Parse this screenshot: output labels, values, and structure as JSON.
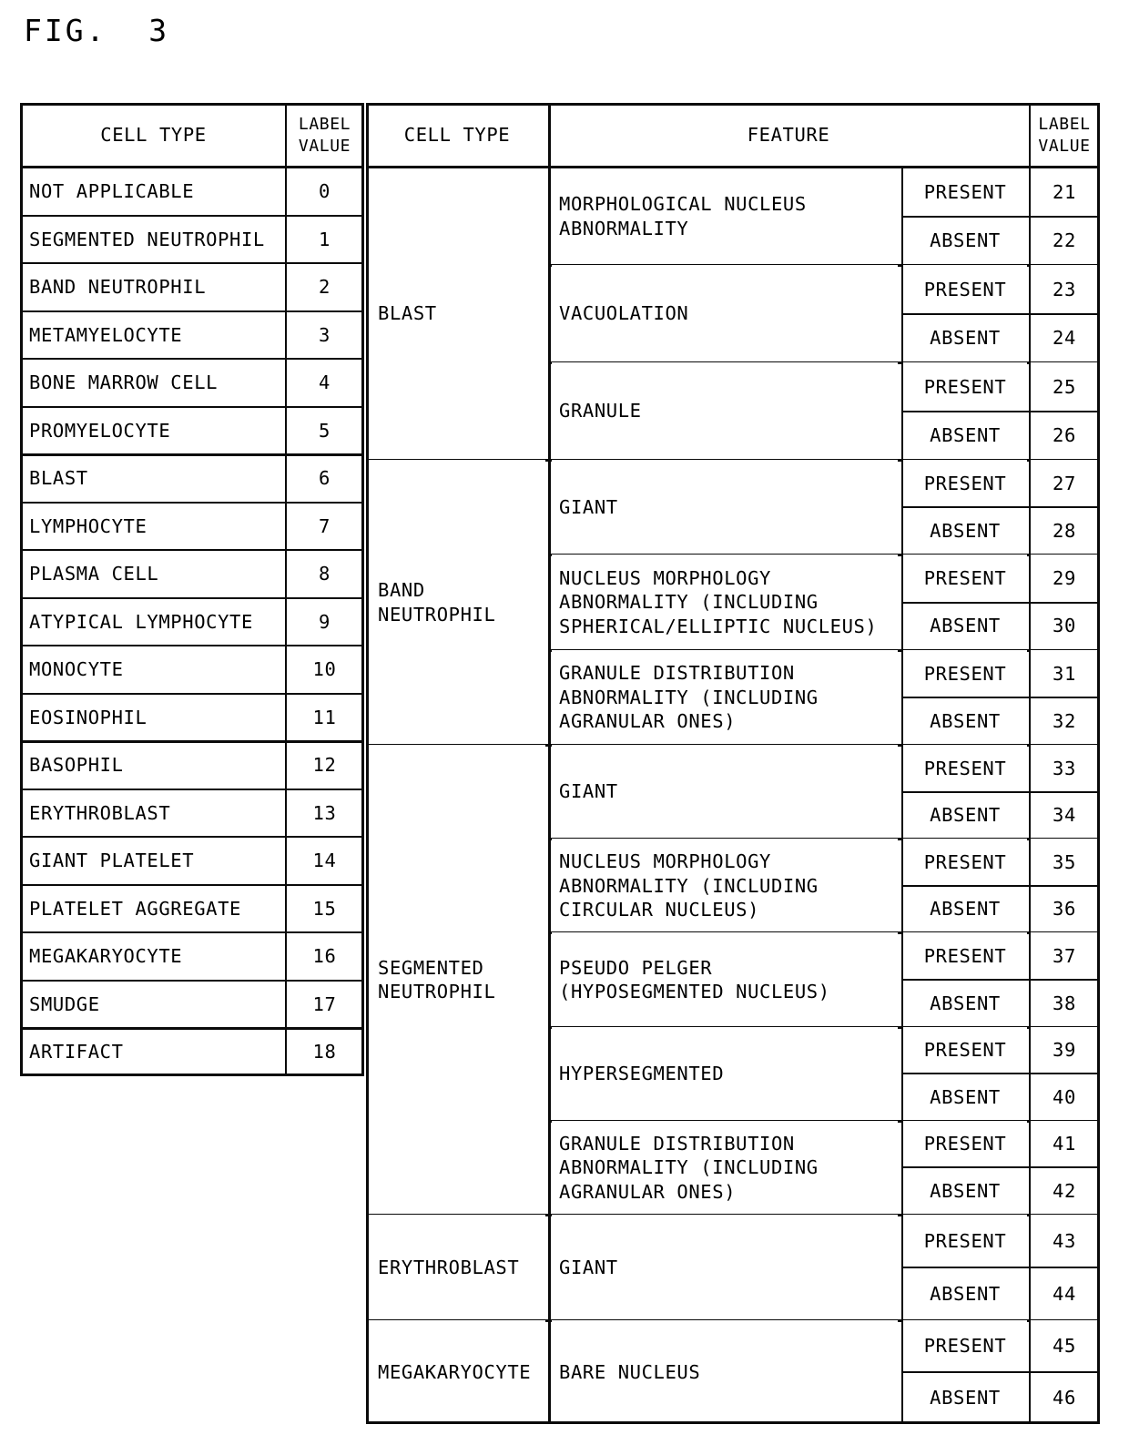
{
  "figure": {
    "label": "FIG.  3"
  },
  "left_table": {
    "headers": {
      "cell_type": "CELL TYPE",
      "label_value": "LABEL\nVALUE"
    },
    "rows": [
      {
        "cell_type": "NOT APPLICABLE",
        "label_value": "0"
      },
      {
        "cell_type": "SEGMENTED NEUTROPHIL",
        "label_value": "1"
      },
      {
        "cell_type": "BAND NEUTROPHIL",
        "label_value": "2"
      },
      {
        "cell_type": "METAMYELOCYTE",
        "label_value": "3"
      },
      {
        "cell_type": "BONE MARROW CELL",
        "label_value": "4"
      },
      {
        "cell_type": "PROMYELOCYTE",
        "label_value": "5"
      },
      {
        "cell_type": "BLAST",
        "label_value": "6"
      },
      {
        "cell_type": "LYMPHOCYTE",
        "label_value": "7"
      },
      {
        "cell_type": "PLASMA CELL",
        "label_value": "8"
      },
      {
        "cell_type": "ATYPICAL LYMPHOCYTE",
        "label_value": "9"
      },
      {
        "cell_type": "MONOCYTE",
        "label_value": "10"
      },
      {
        "cell_type": "EOSINOPHIL",
        "label_value": "11"
      },
      {
        "cell_type": "BASOPHIL",
        "label_value": "12"
      },
      {
        "cell_type": "ERYTHROBLAST",
        "label_value": "13"
      },
      {
        "cell_type": "GIANT PLATELET",
        "label_value": "14"
      },
      {
        "cell_type": "PLATELET AGGREGATE",
        "label_value": "15"
      },
      {
        "cell_type": "MEGAKARYOCYTE",
        "label_value": "16"
      },
      {
        "cell_type": "SMUDGE",
        "label_value": "17"
      },
      {
        "cell_type": "ARTIFACT",
        "label_value": "18"
      }
    ]
  },
  "right_table": {
    "headers": {
      "cell_type": "CELL TYPE",
      "feature": "FEATURE",
      "label_value": "LABEL\nVALUE"
    },
    "state_labels": {
      "present": "PRESENT",
      "absent": "ABSENT"
    },
    "groups": [
      {
        "cell_type": "BLAST",
        "features": [
          {
            "feature": "MORPHOLOGICAL NUCLEUS\nABNORMALITY",
            "present_value": "21",
            "absent_value": "22"
          },
          {
            "feature": "VACUOLATION",
            "present_value": "23",
            "absent_value": "24"
          },
          {
            "feature": "GRANULE",
            "present_value": "25",
            "absent_value": "26"
          }
        ]
      },
      {
        "cell_type": "BAND\nNEUTROPHIL",
        "features": [
          {
            "feature": "GIANT",
            "present_value": "27",
            "absent_value": "28"
          },
          {
            "feature": "NUCLEUS MORPHOLOGY\nABNORMALITY (INCLUDING\nSPHERICAL/ELLIPTIC NUCLEUS)",
            "present_value": "29",
            "absent_value": "30"
          },
          {
            "feature": "GRANULE DISTRIBUTION\nABNORMALITY (INCLUDING\nAGRANULAR ONES)",
            "present_value": "31",
            "absent_value": "32"
          }
        ]
      },
      {
        "cell_type": "SEGMENTED\nNEUTROPHIL",
        "features": [
          {
            "feature": "GIANT",
            "present_value": "33",
            "absent_value": "34"
          },
          {
            "feature": "NUCLEUS MORPHOLOGY\nABNORMALITY (INCLUDING\nCIRCULAR NUCLEUS)",
            "present_value": "35",
            "absent_value": "36"
          },
          {
            "feature": "PSEUDO PELGER\n (HYPOSEGMENTED NUCLEUS)",
            "present_value": "37",
            "absent_value": "38"
          },
          {
            "feature": "HYPERSEGMENTED",
            "present_value": "39",
            "absent_value": "40"
          },
          {
            "feature": "GRANULE DISTRIBUTION\nABNORMALITY (INCLUDING\nAGRANULAR ONES)",
            "present_value": "41",
            "absent_value": "42"
          }
        ]
      },
      {
        "cell_type": "ERYTHROBLAST",
        "features": [
          {
            "feature": "GIANT",
            "present_value": "43",
            "absent_value": "44"
          }
        ]
      },
      {
        "cell_type": "MEGAKARYOCYTE",
        "features": [
          {
            "feature": "BARE NUCLEUS",
            "present_value": "45",
            "absent_value": "46"
          }
        ]
      }
    ]
  }
}
